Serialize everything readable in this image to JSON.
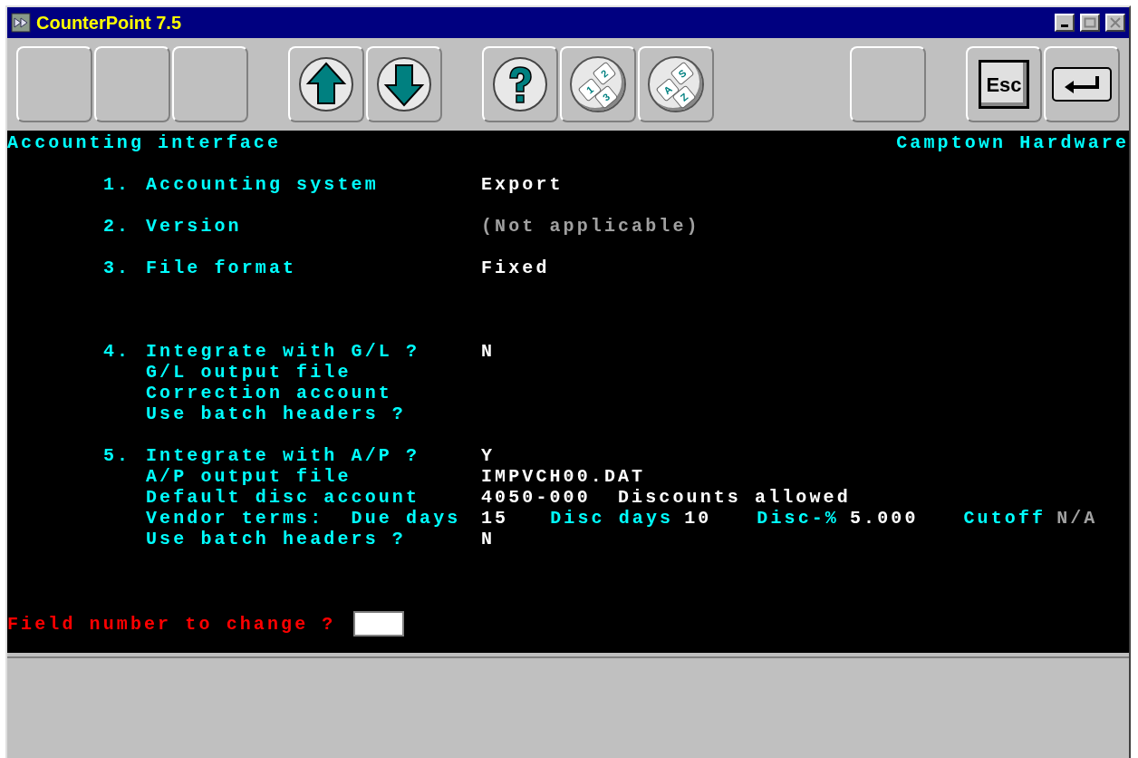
{
  "window": {
    "title": "CounterPoint 7.5",
    "controls": [
      {
        "kind": "minimize",
        "disabled": false
      },
      {
        "kind": "maximize",
        "disabled": true
      },
      {
        "kind": "close",
        "disabled": true
      }
    ]
  },
  "toolbar": [
    {
      "kind": "blank"
    },
    {
      "kind": "blank"
    },
    {
      "kind": "blank"
    },
    {
      "kind": "gap"
    },
    {
      "kind": "up"
    },
    {
      "kind": "down"
    },
    {
      "kind": "gap"
    },
    {
      "kind": "help"
    },
    {
      "kind": "keypad",
      "keys": [
        "1",
        "2",
        "3"
      ]
    },
    {
      "kind": "keypad",
      "keys": [
        "A",
        "S",
        "Z"
      ]
    },
    {
      "kind": "spacer"
    },
    {
      "kind": "blank"
    },
    {
      "kind": "gap"
    },
    {
      "kind": "esc",
      "label": "Esc"
    },
    {
      "kind": "enter"
    }
  ],
  "header": {
    "title": "Accounting interface",
    "company": "Camptown Hardware"
  },
  "fields": [
    {
      "number": "1.",
      "label": "Accounting system",
      "value": "Export",
      "disabled": false
    },
    {
      "number": "2.",
      "label": "Version",
      "value": "(Not applicable)",
      "disabled": true
    },
    {
      "number": "3.",
      "label": "File format",
      "value": "Fixed",
      "disabled": false
    },
    {
      "number": "4.",
      "label": "Integrate with G/L ?",
      "value": "N",
      "disabled": false,
      "rows": [
        {
          "label": "G/L output file"
        },
        {
          "label": "Correction account"
        },
        {
          "label": "Use batch headers ?"
        }
      ]
    },
    {
      "number": "5.",
      "label": "Integrate with A/P ?",
      "value": "Y",
      "disabled": false,
      "rows": [
        {
          "label": "A/P output file",
          "value": "IMPVCH00.DAT"
        },
        {
          "label": "Default disc account",
          "value": "4050-000  Discounts allowed"
        },
        {
          "label": "Vendor terms:  Due days",
          "value": "15",
          "extra": [
            {
              "label": "Disc days",
              "value": "10",
              "disabled": false
            },
            {
              "label": "Disc-%",
              "value": "5.000",
              "disabled": false
            },
            {
              "label": "Cutoff",
              "value": "N/A",
              "disabled": true
            }
          ]
        },
        {
          "label": "Use batch headers ?",
          "value": "N"
        }
      ]
    }
  ],
  "prompt": {
    "label": "Field number to change ?"
  }
}
